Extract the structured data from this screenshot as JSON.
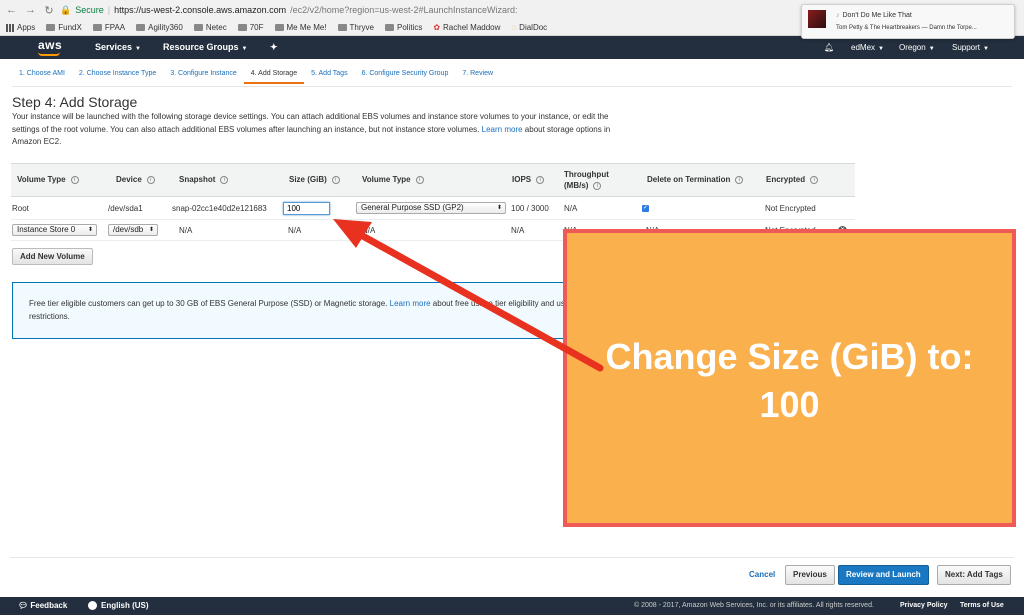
{
  "browser": {
    "secure_label": "Secure",
    "url_host": "https://us-west-2.console.aws.amazon.com",
    "url_rest": "/ec2/v2/home?region=us-west-2#LaunchInstanceWizard:",
    "bookmarks": [
      "Apps",
      "FundX",
      "FPAA",
      "Agility360",
      "Netec",
      "70F",
      "Me Me Me!",
      "Thryve",
      "Politics",
      "Rachel Maddow",
      "DialDoc"
    ]
  },
  "notification": {
    "title": "Don't Do Me Like That",
    "subtitle": "Tom Petty & The Heartbreakers — Damn the Torpe..."
  },
  "awsbar": {
    "logo": "aws",
    "services": "Services",
    "resource_groups": "Resource Groups",
    "account": "edMex",
    "region": "Oregon",
    "support": "Support"
  },
  "tabs": [
    "1. Choose AMI",
    "2. Choose Instance Type",
    "3. Configure Instance",
    "4. Add Storage",
    "5. Add Tags",
    "6. Configure Security Group",
    "7. Review"
  ],
  "page": {
    "title": "Step 4: Add Storage",
    "desc_1": "Your instance will be launched with the following storage device settings. You can attach additional EBS volumes and instance store volumes to your instance, or edit the settings of the root volume. You can also attach additional EBS volumes after launching an instance, but not instance store volumes.",
    "learn_more": "Learn more",
    "desc_2": "about storage options in Amazon EC2."
  },
  "table": {
    "headers": {
      "volume_type": "Volume Type",
      "device": "Device",
      "snapshot": "Snapshot",
      "size": "Size (GiB)",
      "ebs_type": "Volume Type",
      "iops": "IOPS",
      "throughput": "Throughput",
      "throughput_unit": "(MB/s)",
      "delete": "Delete on Termination",
      "encrypted": "Encrypted"
    },
    "row1": {
      "volume_type": "Root",
      "device": "/dev/sda1",
      "snapshot": "snap-02cc1e40d2e121683",
      "size": "100",
      "ebs_type": "General Purpose SSD (GP2)",
      "iops": "100 / 3000",
      "throughput": "N/A",
      "encrypted": "Not Encrypted"
    },
    "row2": {
      "volume_type": "Instance Store 0",
      "device": "/dev/sdb",
      "snapshot": "N/A",
      "size": "N/A",
      "ebs_type": "N/A",
      "iops": "N/A",
      "throughput": "N/A",
      "delete": "N/A",
      "encrypted": "Not Encrypted"
    }
  },
  "add_volume_label": "Add New Volume",
  "freebox": {
    "text_1": "Free tier eligible customers can get up to 30 GB of EBS General Purpose (SSD) or Magnetic storage.",
    "learn_more": "Learn more",
    "text_2": "about free usage tier eligibility and usage restrictions."
  },
  "overlay": {
    "line1": "Change Size (GiB) to:",
    "line2": "100"
  },
  "buttons": {
    "cancel": "Cancel",
    "previous": "Previous",
    "review": "Review and Launch",
    "next": "Next: Add Tags"
  },
  "footer": {
    "feedback": "Feedback",
    "language": "English (US)",
    "copyright": "© 2008 - 2017, Amazon Web Services, Inc. or its affiliates. All rights reserved.",
    "privacy": "Privacy Policy",
    "terms": "Terms of Use"
  },
  "colors": {
    "aws_dark": "#232f3e",
    "aws_orange": "#ff9900",
    "overlay_fill": "#f9b04d",
    "overlay_border": "#ef5956",
    "arrow": "#e8321f"
  }
}
